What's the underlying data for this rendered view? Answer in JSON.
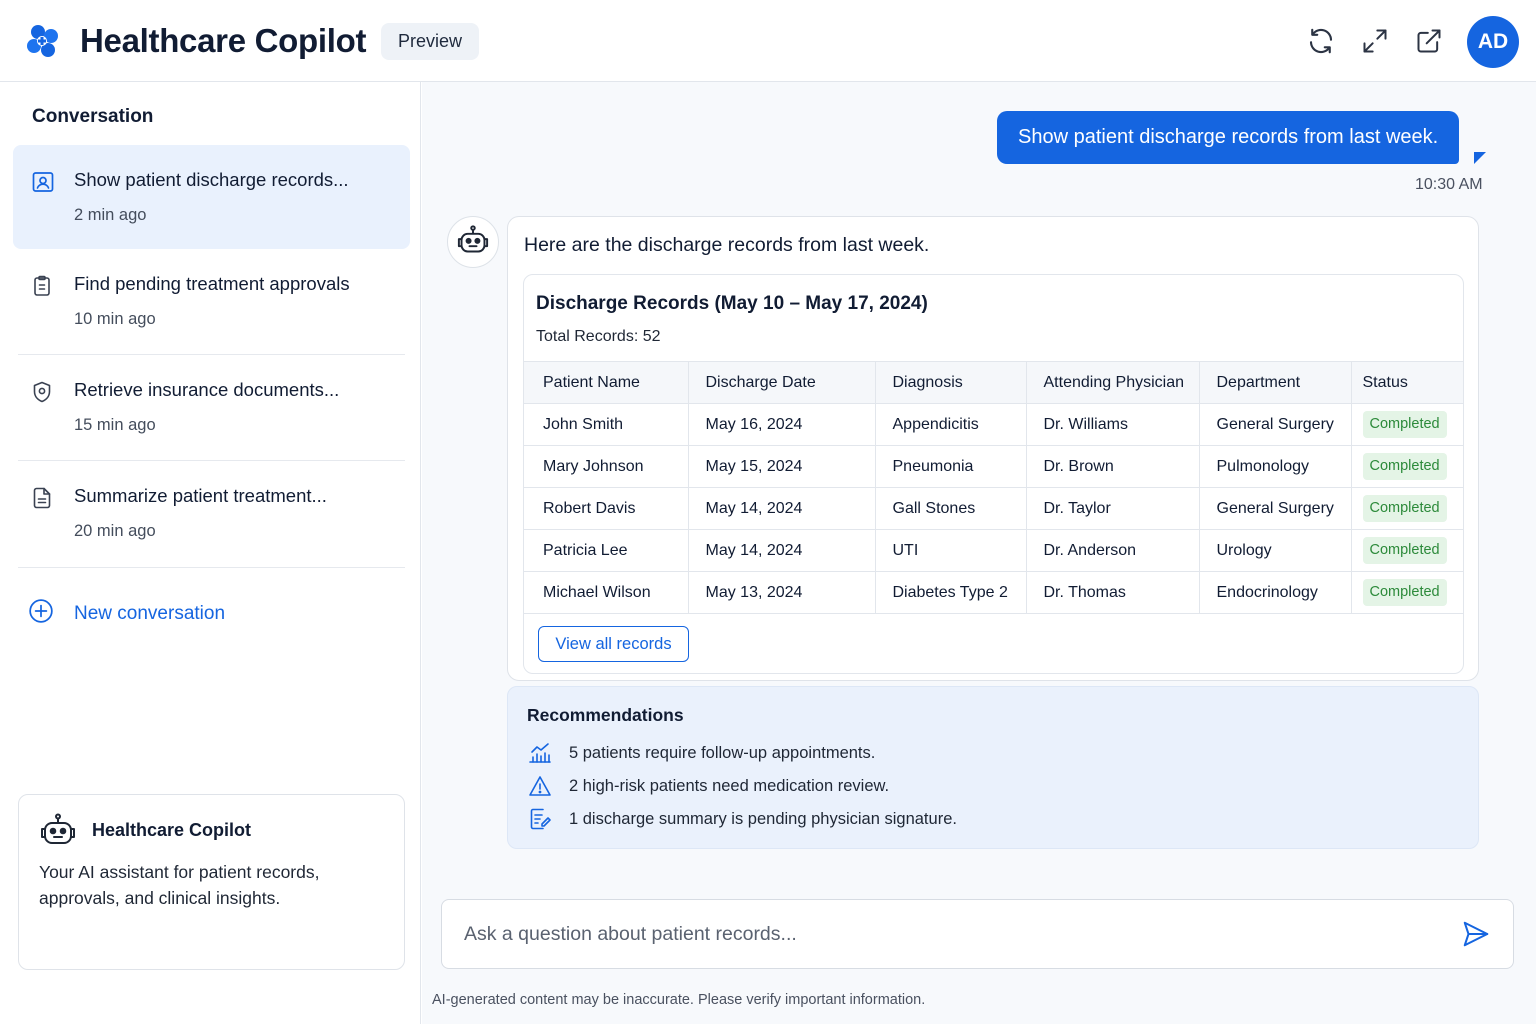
{
  "header": {
    "app_title": "Healthcare Copilot",
    "badge": "Preview",
    "icons": [
      "refresh-icon",
      "expand-icon",
      "external-link-icon"
    ],
    "avatar_initials": "AD",
    "brand_color": "#1565e0"
  },
  "sidebar": {
    "title": "Conversation",
    "items": [
      {
        "label": "Show patient discharge records...",
        "time": "2 min ago",
        "icon": "user-record-icon",
        "active": true
      },
      {
        "label": "Find pending treatment approvals",
        "time": "10 min ago",
        "icon": "clipboard-icon",
        "active": false
      },
      {
        "label": "Retrieve insurance documents...",
        "time": "15 min ago",
        "icon": "shield-icon",
        "active": false
      },
      {
        "label": "Summarize patient treatment...",
        "time": "20 min ago",
        "icon": "document-icon",
        "active": false
      }
    ],
    "new_conversation": "New conversation",
    "info_card": {
      "title": "Healthcare Copilot",
      "description": "Your AI assistant for patient records, approvals, and clinical insights."
    }
  },
  "chat": {
    "user_message": "Show patient discharge records from last week.",
    "user_time": "10:30 AM",
    "bot_intro": "Here are the discharge records from last week.",
    "records": {
      "title": "Discharge Records (May 10 – May 17, 2024)",
      "total": "Total Records: 52",
      "columns": [
        "Patient Name",
        "Discharge Date",
        "Diagnosis",
        "Attending Physician",
        "Department",
        "Status"
      ],
      "rows": [
        [
          "John Smith",
          "May 16, 2024",
          "Appendicitis",
          "Dr. Williams",
          "General Surgery",
          "Completed"
        ],
        [
          "Mary Johnson",
          "May 15, 2024",
          "Pneumonia",
          "Dr. Brown",
          "Pulmonology",
          "Completed"
        ],
        [
          "Robert Davis",
          "May 14, 2024",
          "Gall Stones",
          "Dr. Taylor",
          "General Surgery",
          "Completed"
        ],
        [
          "Patricia Lee",
          "May 14, 2024",
          "UTI",
          "Dr. Anderson",
          "Urology",
          "Completed"
        ],
        [
          "Michael Wilson",
          "May 13, 2024",
          "Diabetes Type 2",
          "Dr. Thomas",
          "Endocrinology",
          "Completed"
        ]
      ],
      "view_all": "View all records"
    },
    "recommendations": {
      "title": "Recommendations",
      "items": [
        {
          "icon": "chart-icon",
          "text": "5 patients require follow-up appointments."
        },
        {
          "icon": "warning-icon",
          "text": "2 high-risk patients need medication review."
        },
        {
          "icon": "signature-doc-icon",
          "text": "1 discharge summary is pending physician signature."
        }
      ]
    }
  },
  "composer": {
    "placeholder": "Ask a question about patient records...",
    "value": "",
    "disclaimer": "AI-generated content may be inaccurate. Please verify important information."
  },
  "colors": {
    "accent": "#1565e0",
    "active_item_bg": "#e9f1fd",
    "status_completed_bg": "#e4f4e6",
    "status_completed_text": "#2c8a3a",
    "recommendation_bg": "#eaf1fc"
  }
}
